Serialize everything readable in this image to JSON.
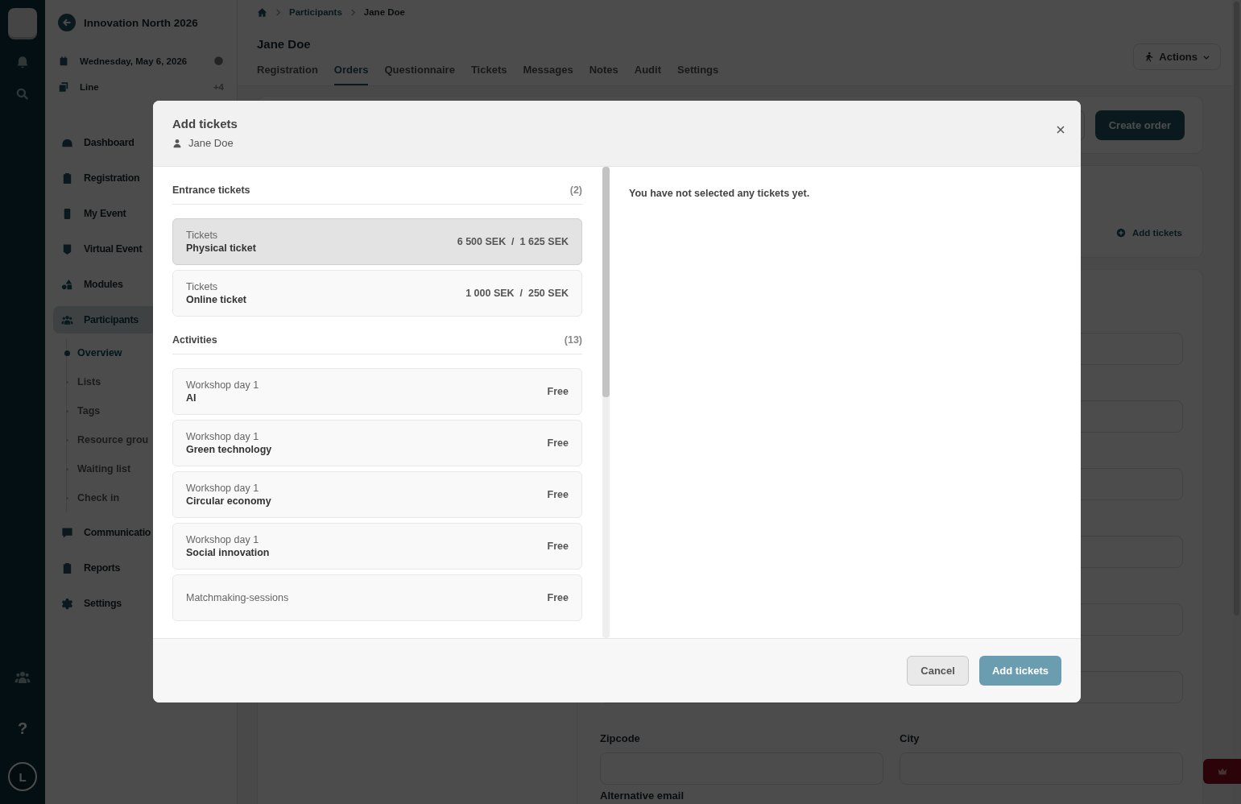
{
  "rail": {
    "help": "?",
    "avatar": "L"
  },
  "sidebar": {
    "event_title": "Innovation North 2026",
    "date": "Wednesday, May 6, 2026",
    "line": {
      "label": "Line",
      "count": "+4"
    },
    "items": [
      {
        "label": "Dashboard",
        "selected": false
      },
      {
        "label": "Registration",
        "selected": false
      },
      {
        "label": "My Event",
        "selected": false
      },
      {
        "label": "Virtual Event",
        "selected": false
      },
      {
        "label": "Modules",
        "selected": false
      },
      {
        "label": "Participants",
        "selected": true,
        "children": [
          {
            "label": "Overview",
            "selected": true
          },
          {
            "label": "Lists",
            "selected": false
          },
          {
            "label": "Tags",
            "selected": false
          },
          {
            "label": "Resource grou",
            "selected": false
          },
          {
            "label": "Waiting list",
            "selected": false
          },
          {
            "label": "Check in",
            "selected": false
          }
        ]
      },
      {
        "label": "Communicatio",
        "selected": false
      },
      {
        "label": "Reports",
        "selected": false
      },
      {
        "label": "Settings",
        "selected": false
      }
    ]
  },
  "breadcrumb": [
    "Participants",
    "Jane Doe"
  ],
  "page_title": "Jane Doe",
  "actions_button": "Actions",
  "tabs": [
    {
      "label": "Registration",
      "selected": false
    },
    {
      "label": "Orders",
      "selected": true
    },
    {
      "label": "Questionnaire",
      "selected": false
    },
    {
      "label": "Tickets",
      "selected": false
    },
    {
      "label": "Messages",
      "selected": false
    },
    {
      "label": "Notes",
      "selected": false
    },
    {
      "label": "Audit",
      "selected": false
    },
    {
      "label": "Settings",
      "selected": false
    }
  ],
  "create_order_button": "Create order",
  "add_tickets_link": "Add tickets",
  "form": {
    "labels": [
      "Zipcode",
      "City",
      "Alternative email"
    ]
  },
  "modal": {
    "title": "Add tickets",
    "participant": "Jane Doe",
    "sections": [
      {
        "title": "Entrance tickets",
        "count": "(2)",
        "items": [
          {
            "category": "Tickets",
            "name": "Physical ticket",
            "price": "6 500 SEK  /  1 625 SEK",
            "hovered": true
          },
          {
            "category": "Tickets",
            "name": "Online ticket",
            "price": "1 000 SEK  /  250 SEK",
            "hovered": false
          }
        ]
      },
      {
        "title": "Activities",
        "count": "(13)",
        "items": [
          {
            "category": "Workshop day 1",
            "name": "AI",
            "price": "Free",
            "hovered": false
          },
          {
            "category": "Workshop day 1",
            "name": "Green technology",
            "price": "Free",
            "hovered": false
          },
          {
            "category": "Workshop day 1",
            "name": "Circular economy",
            "price": "Free",
            "hovered": false
          },
          {
            "category": "Workshop day 1",
            "name": "Social innovation",
            "price": "Free",
            "hovered": false
          },
          {
            "category": "Matchmaking-sessions",
            "price": "Free",
            "hovered": false
          }
        ]
      }
    ],
    "empty_message": "You have not selected any tickets yet.",
    "cancel_button": "Cancel",
    "confirm_button": "Add tickets"
  }
}
